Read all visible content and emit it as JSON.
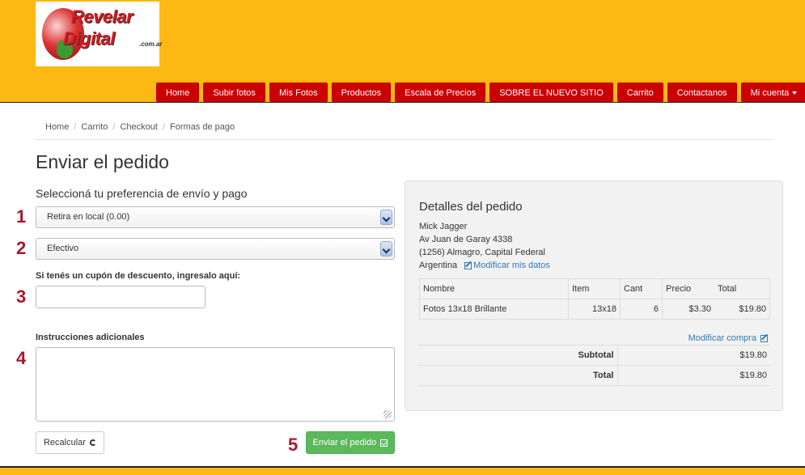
{
  "logo": {
    "line1": "Revelar",
    "line2": "Digital",
    "suffix": ".com.ar"
  },
  "nav": {
    "items": [
      "Home",
      "Subir fotos",
      "Mis Fotos",
      "Productos",
      "Escala de Precios",
      "SOBRE EL NUEVO SITIO",
      "Carrito",
      "Contactanos"
    ],
    "account": "Mi cuenta"
  },
  "breadcrumb": [
    "Home",
    "Carrito",
    "Checkout",
    "Formas de pago"
  ],
  "page_title": "Enviar el pedido",
  "subtitle": "Seleccioná tu preferencia de envío y pago",
  "steps": [
    "1",
    "2",
    "3",
    "4",
    "5"
  ],
  "shipping_select": {
    "value": "Retira en local (0.00)"
  },
  "payment_select": {
    "value": "Efectivo"
  },
  "coupon_label": "Si tenés un cupón de descuento, ingresalo aquí:",
  "coupon_value": "",
  "instructions_label": "Instrucciones adicionales",
  "instructions_value": "",
  "buttons": {
    "recalc": "Recalcular",
    "send": "Enviar el pedido"
  },
  "order": {
    "title": "Detalles del pedido",
    "name": "Mick Jagger",
    "street": "Av Juan de Garay 4338",
    "city": "(1256) Almagro, Capital Federal",
    "country": "Argentina",
    "edit_data": "Modificar mis datos",
    "headers": [
      "Nombre",
      "Item",
      "Cant",
      "Precio",
      "Total"
    ],
    "rows": [
      {
        "nombre": "Fotos 13x18 Brillante",
        "item": "13x18",
        "cant": "6",
        "precio": "$3.30",
        "total": "$19.80"
      }
    ],
    "edit_purchase": "Modificar compra",
    "subtotal_label": "Subtotal",
    "subtotal": "$19.80",
    "total_label": "Total",
    "total": "$19.80"
  },
  "colors": {
    "header": "#fdb813",
    "nav": "#cc0000",
    "step_number": "#a6192e",
    "send_button": "#5cb85c",
    "link": "#337ab7"
  }
}
